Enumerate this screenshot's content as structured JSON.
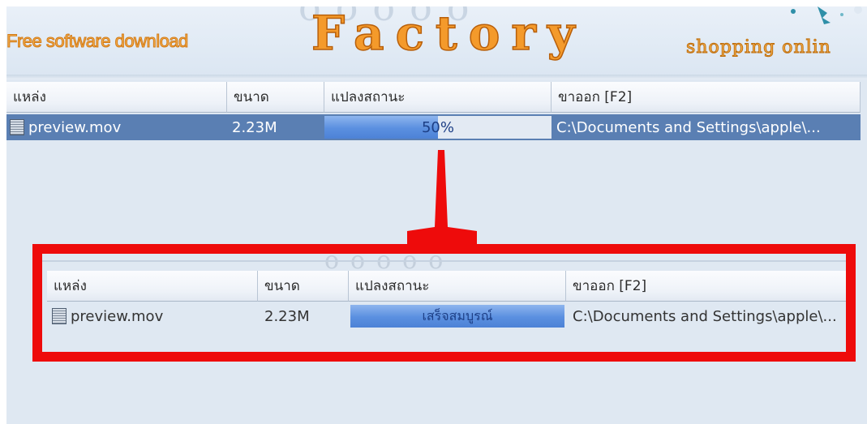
{
  "banner": {
    "tagline": "Free software download",
    "logo": "Factory",
    "shopping": "shopping onlin"
  },
  "table_before": {
    "columns": [
      "แหล่ง",
      "ขนาด",
      "แปลงสถานะ",
      "ขาออก [F2]"
    ],
    "row": {
      "file_name": "preview.mov",
      "size": "2.23M",
      "progress_percent": 50,
      "status_label": "50%",
      "output_path": "C:\\Documents and Settings\\apple\\..."
    }
  },
  "table_after": {
    "columns": [
      "แหล่ง",
      "ขนาด",
      "แปลงสถานะ",
      "ขาออก [F2]"
    ],
    "row": {
      "file_name": "preview.mov",
      "size": "2.23M",
      "progress_percent": 100,
      "status_label": "เสร็จสมบูรณ์",
      "output_path": "C:\\Documents and Settings\\apple\\..."
    }
  },
  "colors": {
    "highlight": "#ee0b0b",
    "selected_row": "#5a7fb3",
    "progress_fill": "#5a8fe0",
    "logo_orange": "#f49a2b"
  },
  "icons": [
    "file-icon",
    "arrow-down-indicator"
  ]
}
